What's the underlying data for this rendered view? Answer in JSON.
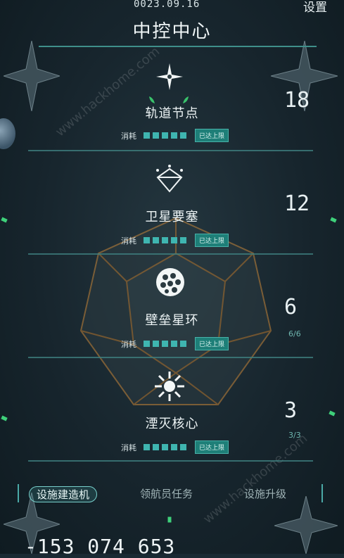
{
  "header": {
    "date": "0023.09.16",
    "settings_label": "设置",
    "title": "中控中心"
  },
  "items": [
    {
      "name": "轨道节点",
      "count": "18",
      "sub": "",
      "cost_label": "消耗",
      "badge": "已达上限",
      "icon": "star-sparkle-icon"
    },
    {
      "name": "卫星要塞",
      "count": "12",
      "sub": "",
      "cost_label": "消耗",
      "badge": "已达上限",
      "icon": "satellite-fortress-icon"
    },
    {
      "name": "壁垒星环",
      "count": "6",
      "sub": "6/6",
      "cost_label": "消耗",
      "badge": "已达上限",
      "icon": "honeycomb-sphere-icon"
    },
    {
      "name": "湮灭核心",
      "count": "3",
      "sub": "3/3",
      "cost_label": "消耗",
      "badge": "已达上限",
      "icon": "burst-core-icon"
    }
  ],
  "tabs": {
    "build": "设施建造机",
    "quest": "领航员任务",
    "upgrade": "设施升级"
  },
  "currency": {
    "value": "-153 074 653"
  },
  "watermark": {
    "text": "www.hackhome.com"
  },
  "colors": {
    "accent": "#3fb5b0",
    "badge": "#1e7f78",
    "background": "#1a2a33",
    "gem": "#3ed07a"
  }
}
